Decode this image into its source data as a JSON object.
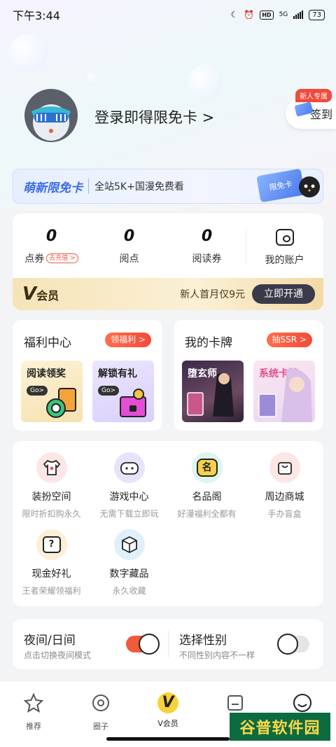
{
  "status_bar": {
    "time": "下午3:44",
    "network": "5G",
    "battery": "73"
  },
  "profile": {
    "login_text": "登录即得限免卡 >",
    "checkin_badge": "新人专属",
    "checkin_label": "签到"
  },
  "promo": {
    "title": "萌新限免卡",
    "text": "全站5K+国漫免费看",
    "card_label": "限免卡"
  },
  "account": {
    "items": [
      {
        "value": "0",
        "label": "点券",
        "tag": "去充值 >"
      },
      {
        "value": "0",
        "label": "阅点"
      },
      {
        "value": "0",
        "label": "阅读券"
      },
      {
        "label": "我的账户"
      }
    ],
    "vip": {
      "logo": "会员",
      "logo_v": "V",
      "offer": "新人首月仅9元",
      "button": "立即开通"
    }
  },
  "welfare": {
    "title": "福利中心",
    "tag": "领福利 >",
    "tiles": [
      {
        "title": "阅读领奖",
        "go": "Go>"
      },
      {
        "title": "解锁有礼",
        "go": "Go>"
      }
    ]
  },
  "cards": {
    "title": "我的卡牌",
    "tag": "抽SSR >",
    "tiles": [
      {
        "title": "堕玄师"
      },
      {
        "title": "系统卡牌"
      }
    ]
  },
  "services": [
    {
      "name": "装扮空间",
      "sub": "限时折扣购永久"
    },
    {
      "name": "游戏中心",
      "sub": "无需下载立即玩"
    },
    {
      "name": "名品阁",
      "sub": "好漫福利全都有",
      "icon_text": "名"
    },
    {
      "name": "周边商城",
      "sub": "手办盲盒"
    },
    {
      "name": "现金好礼",
      "sub": "王者荣耀领福利",
      "icon_text": "?"
    },
    {
      "name": "数字藏品",
      "sub": "永久收藏"
    }
  ],
  "settings": {
    "night": {
      "title": "夜间/日间",
      "sub": "点击切换夜间模式"
    },
    "gender": {
      "title": "选择性别",
      "sub": "不同性别内容不一样"
    }
  },
  "tabs": [
    {
      "label": "推荐"
    },
    {
      "label": "圈子"
    },
    {
      "label": "V会员",
      "icon_text": "V"
    },
    {
      "label": ""
    },
    {
      "label": ""
    }
  ],
  "watermark": "谷普软件园",
  "colors": {
    "accent_red": "#f24a3b",
    "promo_blue": "#3d6be8",
    "vip_gold": "#f6e4b8"
  }
}
